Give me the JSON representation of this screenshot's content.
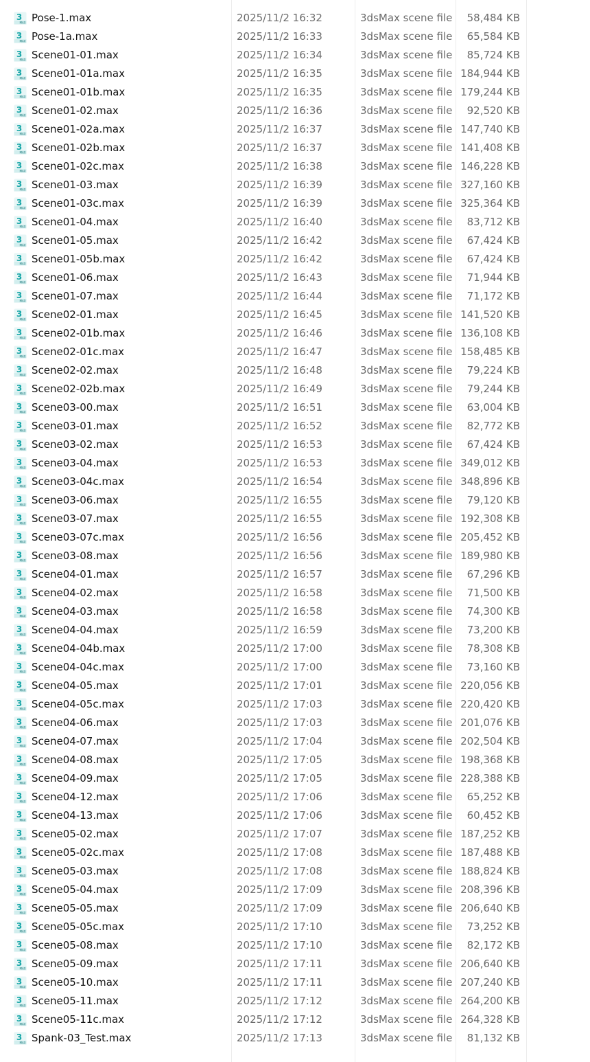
{
  "colors": {
    "icon_teal": "#1aa7a8",
    "icon_dark_teal": "#0b6f72",
    "secondary_text": "#6b6b6b"
  },
  "icon_name": "3dsmax-file-icon",
  "files": [
    {
      "name": "Pose-1.max",
      "date": "2025/11/2 16:32",
      "type": "3dsMax scene file",
      "size": "58,484 KB"
    },
    {
      "name": "Pose-1a.max",
      "date": "2025/11/2 16:33",
      "type": "3dsMax scene file",
      "size": "65,584 KB"
    },
    {
      "name": "Scene01-01.max",
      "date": "2025/11/2 16:34",
      "type": "3dsMax scene file",
      "size": "85,724 KB"
    },
    {
      "name": "Scene01-01a.max",
      "date": "2025/11/2 16:35",
      "type": "3dsMax scene file",
      "size": "184,944 KB"
    },
    {
      "name": "Scene01-01b.max",
      "date": "2025/11/2 16:35",
      "type": "3dsMax scene file",
      "size": "179,244 KB"
    },
    {
      "name": "Scene01-02.max",
      "date": "2025/11/2 16:36",
      "type": "3dsMax scene file",
      "size": "92,520 KB"
    },
    {
      "name": "Scene01-02a.max",
      "date": "2025/11/2 16:37",
      "type": "3dsMax scene file",
      "size": "147,740 KB"
    },
    {
      "name": "Scene01-02b.max",
      "date": "2025/11/2 16:37",
      "type": "3dsMax scene file",
      "size": "141,408 KB"
    },
    {
      "name": "Scene01-02c.max",
      "date": "2025/11/2 16:38",
      "type": "3dsMax scene file",
      "size": "146,228 KB"
    },
    {
      "name": "Scene01-03.max",
      "date": "2025/11/2 16:39",
      "type": "3dsMax scene file",
      "size": "327,160 KB"
    },
    {
      "name": "Scene01-03c.max",
      "date": "2025/11/2 16:39",
      "type": "3dsMax scene file",
      "size": "325,364 KB"
    },
    {
      "name": "Scene01-04.max",
      "date": "2025/11/2 16:40",
      "type": "3dsMax scene file",
      "size": "83,712 KB"
    },
    {
      "name": "Scene01-05.max",
      "date": "2025/11/2 16:42",
      "type": "3dsMax scene file",
      "size": "67,424 KB"
    },
    {
      "name": "Scene01-05b.max",
      "date": "2025/11/2 16:42",
      "type": "3dsMax scene file",
      "size": "67,424 KB"
    },
    {
      "name": "Scene01-06.max",
      "date": "2025/11/2 16:43",
      "type": "3dsMax scene file",
      "size": "71,944 KB"
    },
    {
      "name": "Scene01-07.max",
      "date": "2025/11/2 16:44",
      "type": "3dsMax scene file",
      "size": "71,172 KB"
    },
    {
      "name": "Scene02-01.max",
      "date": "2025/11/2 16:45",
      "type": "3dsMax scene file",
      "size": "141,520 KB"
    },
    {
      "name": "Scene02-01b.max",
      "date": "2025/11/2 16:46",
      "type": "3dsMax scene file",
      "size": "136,108 KB"
    },
    {
      "name": "Scene02-01c.max",
      "date": "2025/11/2 16:47",
      "type": "3dsMax scene file",
      "size": "158,485 KB"
    },
    {
      "name": "Scene02-02.max",
      "date": "2025/11/2 16:48",
      "type": "3dsMax scene file",
      "size": "79,224 KB"
    },
    {
      "name": "Scene02-02b.max",
      "date": "2025/11/2 16:49",
      "type": "3dsMax scene file",
      "size": "79,244 KB"
    },
    {
      "name": "Scene03-00.max",
      "date": "2025/11/2 16:51",
      "type": "3dsMax scene file",
      "size": "63,004 KB"
    },
    {
      "name": "Scene03-01.max",
      "date": "2025/11/2 16:52",
      "type": "3dsMax scene file",
      "size": "82,772 KB"
    },
    {
      "name": "Scene03-02.max",
      "date": "2025/11/2 16:53",
      "type": "3dsMax scene file",
      "size": "67,424 KB"
    },
    {
      "name": "Scene03-04.max",
      "date": "2025/11/2 16:53",
      "type": "3dsMax scene file",
      "size": "349,012 KB"
    },
    {
      "name": "Scene03-04c.max",
      "date": "2025/11/2 16:54",
      "type": "3dsMax scene file",
      "size": "348,896 KB"
    },
    {
      "name": "Scene03-06.max",
      "date": "2025/11/2 16:55",
      "type": "3dsMax scene file",
      "size": "79,120 KB"
    },
    {
      "name": "Scene03-07.max",
      "date": "2025/11/2 16:55",
      "type": "3dsMax scene file",
      "size": "192,308 KB"
    },
    {
      "name": "Scene03-07c.max",
      "date": "2025/11/2 16:56",
      "type": "3dsMax scene file",
      "size": "205,452 KB"
    },
    {
      "name": "Scene03-08.max",
      "date": "2025/11/2 16:56",
      "type": "3dsMax scene file",
      "size": "189,980 KB"
    },
    {
      "name": "Scene04-01.max",
      "date": "2025/11/2 16:57",
      "type": "3dsMax scene file",
      "size": "67,296 KB"
    },
    {
      "name": "Scene04-02.max",
      "date": "2025/11/2 16:58",
      "type": "3dsMax scene file",
      "size": "71,500 KB"
    },
    {
      "name": "Scene04-03.max",
      "date": "2025/11/2 16:58",
      "type": "3dsMax scene file",
      "size": "74,300 KB"
    },
    {
      "name": "Scene04-04.max",
      "date": "2025/11/2 16:59",
      "type": "3dsMax scene file",
      "size": "73,200 KB"
    },
    {
      "name": "Scene04-04b.max",
      "date": "2025/11/2 17:00",
      "type": "3dsMax scene file",
      "size": "78,308 KB"
    },
    {
      "name": "Scene04-04c.max",
      "date": "2025/11/2 17:00",
      "type": "3dsMax scene file",
      "size": "73,160 KB"
    },
    {
      "name": "Scene04-05.max",
      "date": "2025/11/2 17:01",
      "type": "3dsMax scene file",
      "size": "220,056 KB"
    },
    {
      "name": "Scene04-05c.max",
      "date": "2025/11/2 17:03",
      "type": "3dsMax scene file",
      "size": "220,420 KB"
    },
    {
      "name": "Scene04-06.max",
      "date": "2025/11/2 17:03",
      "type": "3dsMax scene file",
      "size": "201,076 KB"
    },
    {
      "name": "Scene04-07.max",
      "date": "2025/11/2 17:04",
      "type": "3dsMax scene file",
      "size": "202,504 KB"
    },
    {
      "name": "Scene04-08.max",
      "date": "2025/11/2 17:05",
      "type": "3dsMax scene file",
      "size": "198,368 KB"
    },
    {
      "name": "Scene04-09.max",
      "date": "2025/11/2 17:05",
      "type": "3dsMax scene file",
      "size": "228,388 KB"
    },
    {
      "name": "Scene04-12.max",
      "date": "2025/11/2 17:06",
      "type": "3dsMax scene file",
      "size": "65,252 KB"
    },
    {
      "name": "Scene04-13.max",
      "date": "2025/11/2 17:06",
      "type": "3dsMax scene file",
      "size": "60,452 KB"
    },
    {
      "name": "Scene05-02.max",
      "date": "2025/11/2 17:07",
      "type": "3dsMax scene file",
      "size": "187,252 KB"
    },
    {
      "name": "Scene05-02c.max",
      "date": "2025/11/2 17:08",
      "type": "3dsMax scene file",
      "size": "187,488 KB"
    },
    {
      "name": "Scene05-03.max",
      "date": "2025/11/2 17:08",
      "type": "3dsMax scene file",
      "size": "188,824 KB"
    },
    {
      "name": "Scene05-04.max",
      "date": "2025/11/2 17:09",
      "type": "3dsMax scene file",
      "size": "208,396 KB"
    },
    {
      "name": "Scene05-05.max",
      "date": "2025/11/2 17:09",
      "type": "3dsMax scene file",
      "size": "206,640 KB"
    },
    {
      "name": "Scene05-05c.max",
      "date": "2025/11/2 17:10",
      "type": "3dsMax scene file",
      "size": "73,252 KB"
    },
    {
      "name": "Scene05-08.max",
      "date": "2025/11/2 17:10",
      "type": "3dsMax scene file",
      "size": "82,172 KB"
    },
    {
      "name": "Scene05-09.max",
      "date": "2025/11/2 17:11",
      "type": "3dsMax scene file",
      "size": "206,640 KB"
    },
    {
      "name": "Scene05-10.max",
      "date": "2025/11/2 17:11",
      "type": "3dsMax scene file",
      "size": "207,240 KB"
    },
    {
      "name": "Scene05-11.max",
      "date": "2025/11/2 17:12",
      "type": "3dsMax scene file",
      "size": "264,200 KB"
    },
    {
      "name": "Scene05-11c.max",
      "date": "2025/11/2 17:12",
      "type": "3dsMax scene file",
      "size": "264,328 KB"
    },
    {
      "name": "Spank-03_Test.max",
      "date": "2025/11/2 17:13",
      "type": "3dsMax scene file",
      "size": "81,132 KB"
    }
  ]
}
